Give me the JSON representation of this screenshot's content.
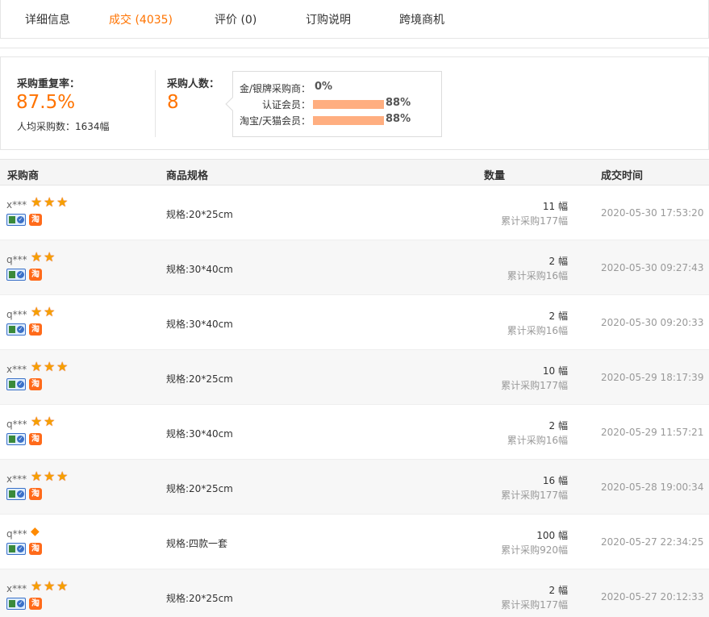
{
  "tabs": [
    {
      "label": "详细信息"
    },
    {
      "label": "成交 (4035)"
    },
    {
      "label": "评价 (0)"
    },
    {
      "label": "订购说明"
    },
    {
      "label": "跨境商机"
    }
  ],
  "stats": {
    "repeat_label": "采购重复率：",
    "repeat_value": "87.5%",
    "avg_label": "人均采购数：1634幅",
    "buyers_label": "采购人数：",
    "buyers_value": "8",
    "breakdown": [
      {
        "label": "金/银牌采购商：",
        "value": "0%",
        "fraction": 0
      },
      {
        "label": "认证会员：",
        "value": "88%",
        "fraction": 0.88
      },
      {
        "label": "淘宝/天猫会员：",
        "value": "88%",
        "fraction": 0.88
      }
    ],
    "bar_color": "#ffae80"
  },
  "table": {
    "headers": {
      "buyer": "采购商",
      "spec": "商品规格",
      "qty": "数量",
      "time": "成交时间"
    },
    "tao_badge": "淘",
    "rows": [
      {
        "buyer": "x***",
        "level": "3-star",
        "spec": "规格:20*25cm",
        "qty": "11 幅",
        "total": "累计采购177幅",
        "time": "2020-05-30 17:53:20"
      },
      {
        "buyer": "q***",
        "level": "2-star",
        "spec": "规格:30*40cm",
        "qty": "2 幅",
        "total": "累计采购16幅",
        "time": "2020-05-30 09:27:43"
      },
      {
        "buyer": "q***",
        "level": "2-star",
        "spec": "规格:30*40cm",
        "qty": "2 幅",
        "total": "累计采购16幅",
        "time": "2020-05-30 09:20:33"
      },
      {
        "buyer": "x***",
        "level": "3-star",
        "spec": "规格:20*25cm",
        "qty": "10 幅",
        "total": "累计采购177幅",
        "time": "2020-05-29 18:17:39"
      },
      {
        "buyer": "q***",
        "level": "2-star",
        "spec": "规格:30*40cm",
        "qty": "2 幅",
        "total": "累计采购16幅",
        "time": "2020-05-29 11:57:21"
      },
      {
        "buyer": "x***",
        "level": "3-star",
        "spec": "规格:20*25cm",
        "qty": "16 幅",
        "total": "累计采购177幅",
        "time": "2020-05-28 19:00:34"
      },
      {
        "buyer": "q***",
        "level": "1-diamond",
        "spec": "规格:四款一套",
        "qty": "100 幅",
        "total": "累计采购920幅",
        "time": "2020-05-27 22:34:25"
      },
      {
        "buyer": "x***",
        "level": "3-star",
        "spec": "规格:20*25cm",
        "qty": "2 幅",
        "total": "累计采购177幅",
        "time": "2020-05-27 20:12:33"
      }
    ]
  }
}
